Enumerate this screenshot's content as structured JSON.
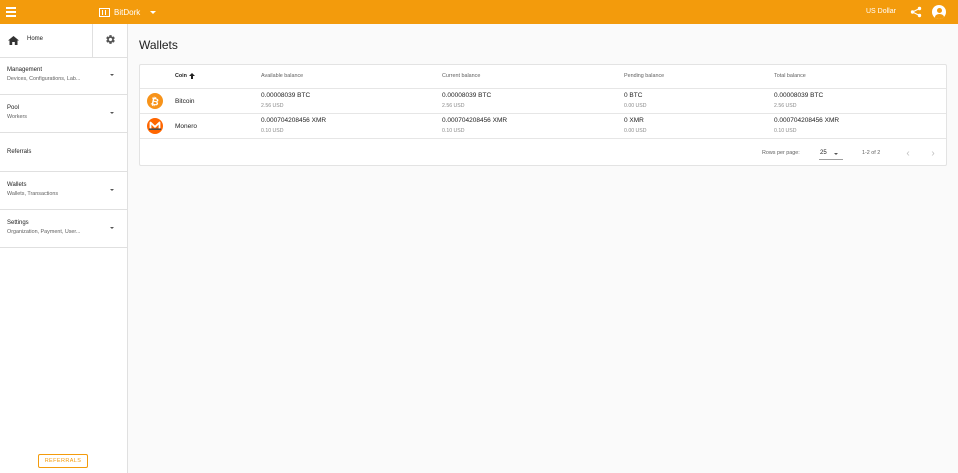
{
  "topbar": {
    "org_name": "BitDork",
    "currency": "US Dollar",
    "icons": [
      "menu-icon",
      "organization-icon",
      "share-icon",
      "account-icon"
    ]
  },
  "sidebar": {
    "home_label": "Home",
    "items": [
      {
        "title": "Management",
        "subtitle": "Devices, Configurations, Lab..."
      },
      {
        "title": "Pool",
        "subtitle": "Workers"
      },
      {
        "title": "Referrals",
        "subtitle": ""
      },
      {
        "title": "Wallets",
        "subtitle": "Wallets, Transactions"
      },
      {
        "title": "Settings",
        "subtitle": "Organization, Payment, User..."
      }
    ],
    "referrals_button": "REFERRALS"
  },
  "main": {
    "title": "Wallets",
    "columns": {
      "coin": "Coin",
      "available": "Available balance",
      "current": "Current balance",
      "pending": "Pending balance",
      "total": "Total balance"
    },
    "rows": [
      {
        "coin": "Bitcoin",
        "icon": "bitcoin-icon",
        "color": "#f7931a",
        "available": "0.00008039 BTC",
        "available_fiat": "2.56 USD",
        "current": "0.00008039 BTC",
        "current_fiat": "2.56 USD",
        "pending": "0 BTC",
        "pending_fiat": "0.00 USD",
        "total": "0.00008039 BTC",
        "total_fiat": "2.56 USD"
      },
      {
        "coin": "Monero",
        "icon": "monero-icon",
        "color": "#ff6600",
        "available": "0.000704208456 XMR",
        "available_fiat": "0.10 USD",
        "current": "0.000704208456 XMR",
        "current_fiat": "0.10 USD",
        "pending": "0 XMR",
        "pending_fiat": "0.00 USD",
        "total": "0.000704208456 XMR",
        "total_fiat": "0.10 USD"
      }
    ],
    "pagination": {
      "rows_per_page_label": "Rows per page:",
      "rows_per_page": "25",
      "range": "1-2 of 2"
    }
  },
  "colors": {
    "accent": "#f39b0c"
  }
}
